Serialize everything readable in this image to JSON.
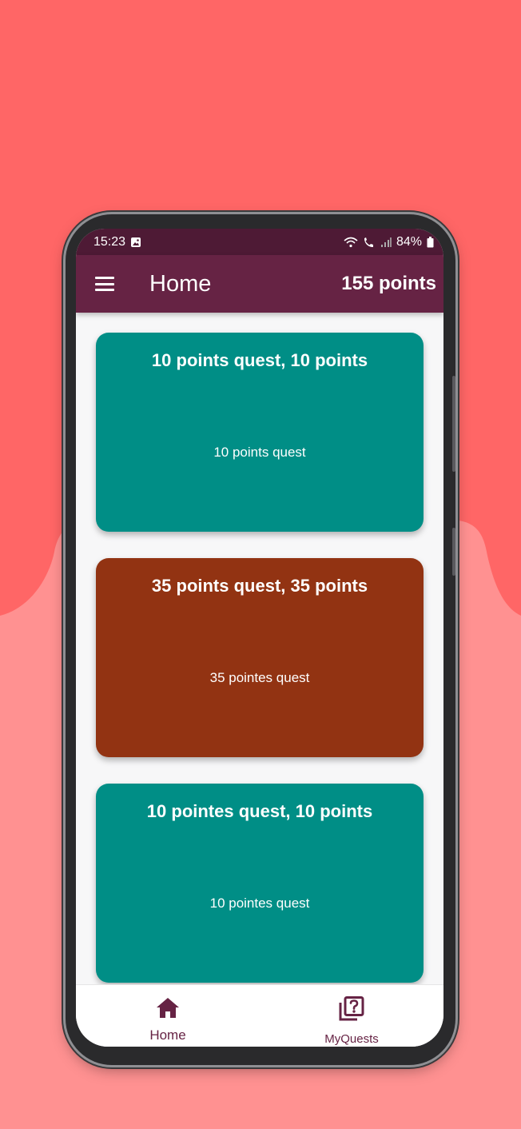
{
  "colors": {
    "background_top": "#ff6666",
    "background_bottom": "#ff9191",
    "status_bar": "#4e1a35",
    "app_bar": "#662344",
    "accent": "#662344",
    "card_teal": "#008e86",
    "card_brown": "#923312"
  },
  "status_bar": {
    "time": "15:23",
    "battery": "84%",
    "icons": [
      "gallery-icon",
      "wifi-icon",
      "wifi-calling-icon",
      "signal-icon",
      "battery-icon"
    ]
  },
  "app_bar": {
    "menu_icon": "menu-icon",
    "title": "Home",
    "points": "155 points"
  },
  "quests": [
    {
      "title": "10 points quest, 10 points",
      "description": "10 points quest",
      "color": "#008e86"
    },
    {
      "title": "35 points quest, 35 points",
      "description": "35 pointes quest",
      "color": "#923312"
    },
    {
      "title": "10 pointes quest, 10 points",
      "description": "10 pointes quest",
      "color": "#008e86"
    }
  ],
  "bottom_nav": {
    "items": [
      {
        "label": "Home",
        "icon": "home-icon"
      },
      {
        "label": "MyQuests",
        "icon": "quests-icon"
      }
    ]
  }
}
